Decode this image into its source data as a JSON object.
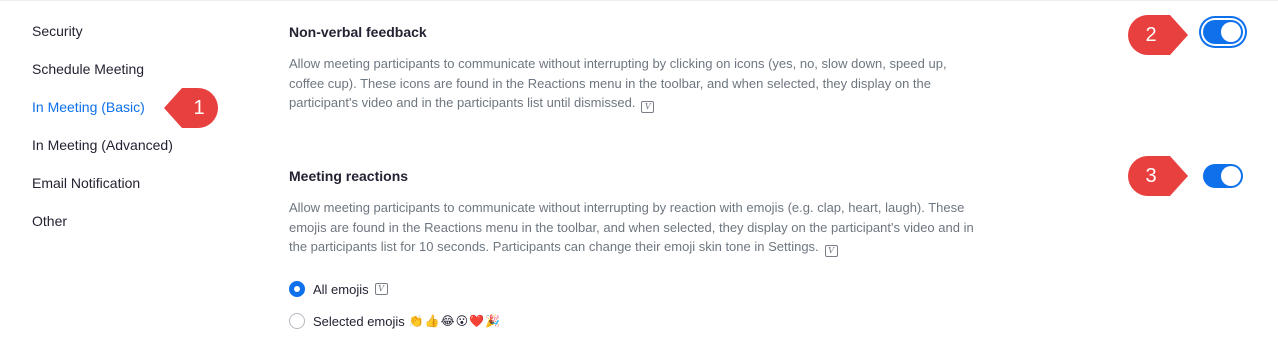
{
  "sidebar": {
    "items": [
      {
        "label": "Security"
      },
      {
        "label": "Schedule Meeting"
      },
      {
        "label": "In Meeting (Basic)",
        "active": true
      },
      {
        "label": "In Meeting (Advanced)"
      },
      {
        "label": "Email Notification"
      },
      {
        "label": "Other"
      }
    ]
  },
  "settings": {
    "nonverbal": {
      "title": "Non-verbal feedback",
      "description": "Allow meeting participants to communicate without interrupting by clicking on icons (yes, no, slow down, speed up, coffee cup). These icons are found in the Reactions menu in the toolbar, and when selected, they display on the participant's video and in the participants list until dismissed.",
      "enabled": true
    },
    "reactions": {
      "title": "Meeting reactions",
      "description": "Allow meeting participants to communicate without interrupting by reaction with emojis (e.g. clap, heart, laugh). These emojis are found in the Reactions menu in the toolbar, and when selected, they display on the participant's video and in the participants list for 10 seconds. Participants can change their emoji skin tone in Settings.",
      "enabled": true,
      "options": [
        {
          "label": "All emojis",
          "checked": true
        },
        {
          "label": "Selected emojis",
          "checked": false,
          "emojis": "👏👍😂😮❤️🎉"
        }
      ]
    }
  },
  "icons": {
    "version_icon": "V",
    "version_icon_name": "version-icon"
  },
  "callouts": {
    "one": "1",
    "two": "2",
    "three": "3",
    "color": "#e8403f"
  },
  "colors": {
    "accent": "#0e71eb",
    "text": "#232333",
    "muted": "#6e7680"
  }
}
